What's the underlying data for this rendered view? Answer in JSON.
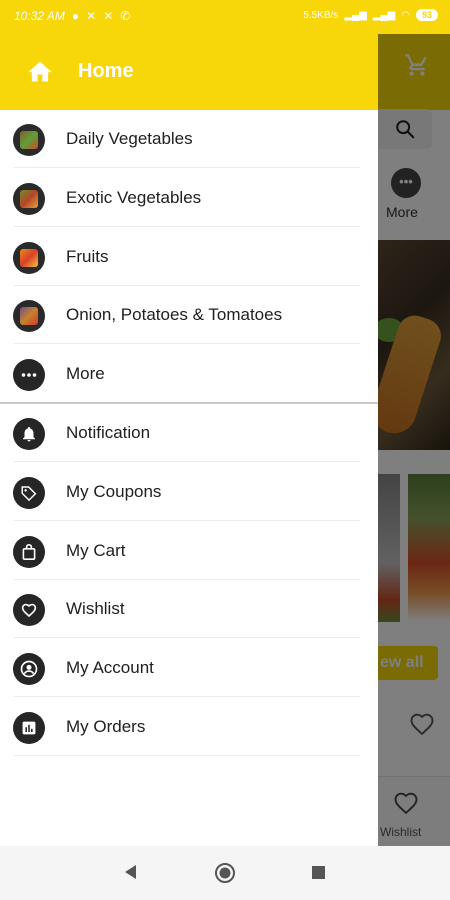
{
  "status_bar": {
    "time": "10:32 AM",
    "net_speed": "5.5KB/s",
    "battery": "93"
  },
  "drawer": {
    "header_title": "Home",
    "categories": [
      {
        "label": "Daily Vegetables",
        "icon": "daily-vegetables-thumbnail"
      },
      {
        "label": "Exotic Vegetables",
        "icon": "exotic-vegetables-thumbnail"
      },
      {
        "label": "Fruits",
        "icon": "fruits-thumbnail"
      },
      {
        "label": "Onion, Potatoes & Tomatoes",
        "icon": "onion-potatoes-tomatoes-thumbnail"
      },
      {
        "label": "More",
        "icon": "more-dots-icon"
      }
    ],
    "account_items": [
      {
        "label": "Notification",
        "icon": "bell-icon"
      },
      {
        "label": "My Coupons",
        "icon": "tag-icon"
      },
      {
        "label": "My Cart",
        "icon": "shopping-bag-icon"
      },
      {
        "label": "Wishlist",
        "icon": "heart-icon"
      },
      {
        "label": "My Account",
        "icon": "account-circle-icon"
      },
      {
        "label": "My Orders",
        "icon": "orders-icon"
      }
    ]
  },
  "background_app": {
    "more_label": "More",
    "view_all_label": "View all",
    "view_all_visible": "ew all",
    "wishlist_tab_label": "Wishlist"
  },
  "colors": {
    "accent": "#f7d60a",
    "dark_icon": "#262626",
    "text": "#202020"
  }
}
